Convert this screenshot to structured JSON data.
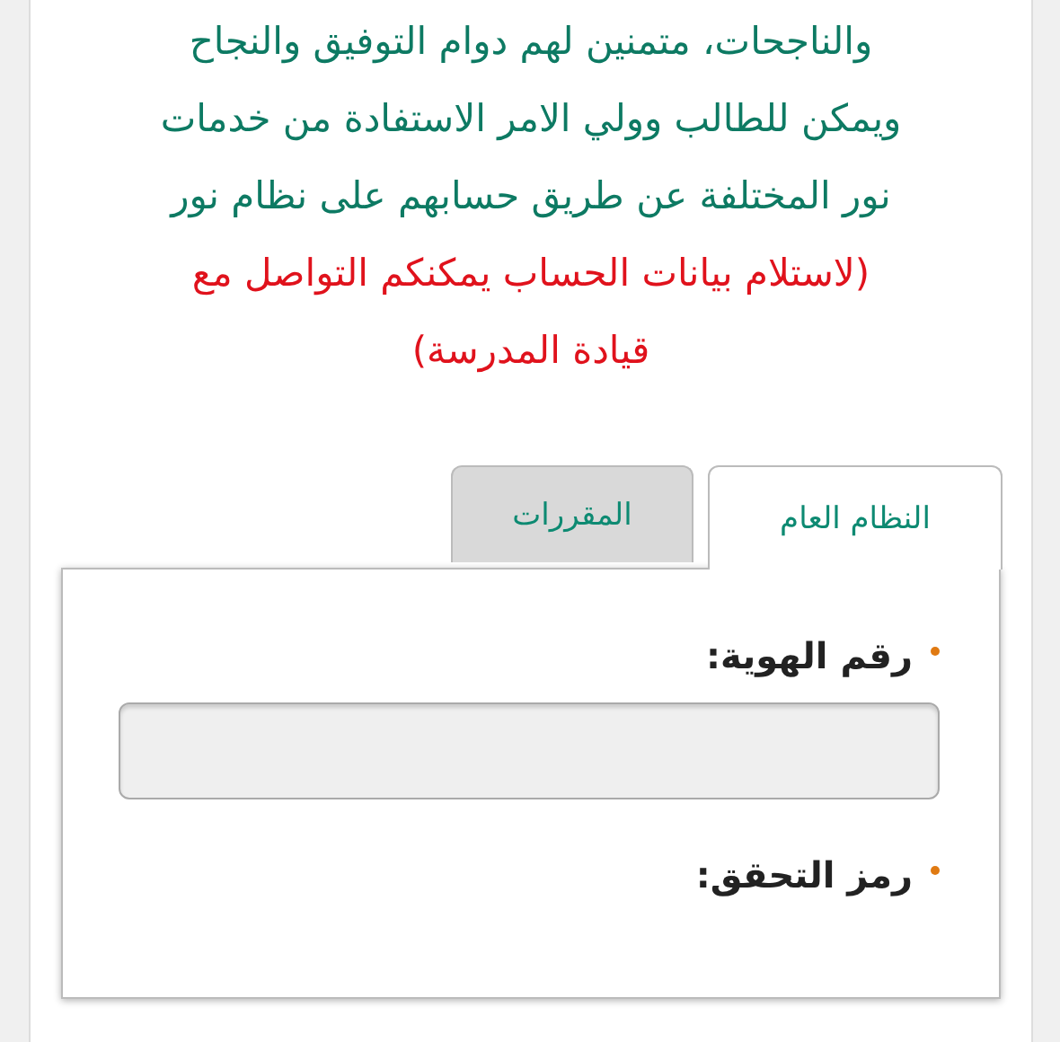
{
  "intro_lines": [
    "والناجحات، متمنين لهم دوام التوفيق والنجاح",
    "ويمكن للطالب وولي الامر الاستفادة من خدمات",
    "نور المختلفة عن طريق حسابهم على نظام نور"
  ],
  "notice_lines": [
    "(لاستلام بيانات الحساب يمكنكم التواصل مع",
    "قيادة المدرسة)"
  ],
  "tabs": [
    {
      "label": "النظام العام",
      "selected": true
    },
    {
      "label": "المقررات",
      "selected": false
    }
  ],
  "fields": [
    {
      "label": "رقم الهوية:",
      "required": true,
      "kind": "input"
    },
    {
      "label": "رمز التحقق:",
      "required": true,
      "kind": "label-only"
    }
  ]
}
